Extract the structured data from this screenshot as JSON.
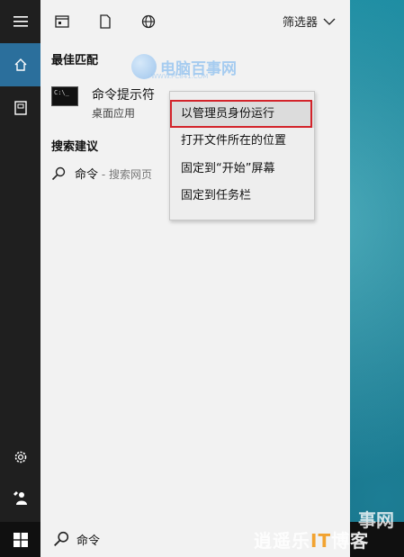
{
  "panel": {
    "filter_label": "筛选器",
    "best_match_heading": "最佳匹配",
    "best_match_item": {
      "title": "命令提示符",
      "subtitle": "桌面应用",
      "icon_text": "C:\\_"
    },
    "search_suggest_heading": "搜索建议",
    "suggestion": {
      "query": "命令",
      "sub": " - 搜索网页"
    }
  },
  "context_menu": {
    "items": [
      {
        "label": "以管理员身份运行",
        "highlighted": true
      },
      {
        "label": "打开文件所在的位置",
        "highlighted": false
      },
      {
        "label": "固定到“开始”屏幕",
        "highlighted": false
      },
      {
        "label": "固定到任务栏",
        "highlighted": false
      }
    ],
    "highlight_border_color": "#d3232a"
  },
  "taskbar": {
    "search_value": "命令"
  },
  "watermarks": {
    "top_brand": "电脑百事网",
    "top_url": "WWW.PC841.COM",
    "bottom_line1": "事网",
    "bottom_brand_a": "逍遥乐",
    "bottom_brand_b": "IT",
    "bottom_brand_c": "博客"
  },
  "colors": {
    "rail_bg": "#1f1f1f",
    "active_rail": "#2b6f9c",
    "panel_bg": "#f2f2f2"
  }
}
